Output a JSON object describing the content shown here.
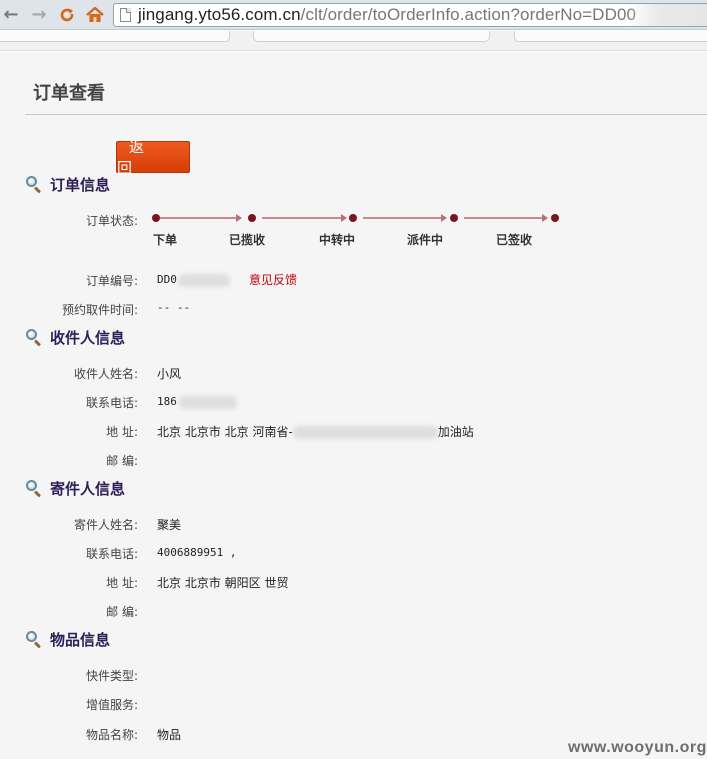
{
  "browser": {
    "url_host": "jingang.yto56.com.cn",
    "url_path": "/clt/order/toOrderInfo.action?orderNo=DD00"
  },
  "page": {
    "title": "订单查看",
    "back_label": "返 回"
  },
  "order_section": {
    "title": "订单信息",
    "status_label": "订单状态:",
    "steps": [
      "下单",
      "已揽收",
      "中转中",
      "派件中",
      "已签收"
    ],
    "order_no_label": "订单编号:",
    "order_no_prefix": "DD0",
    "feedback_link": "意见反馈",
    "pickup_time_label": "预约取件时间:",
    "pickup_time": "-- --"
  },
  "receiver_section": {
    "title": "收件人信息",
    "name_label": "收件人姓名:",
    "name": "小风",
    "phone_label": "联系电话:",
    "phone_prefix": "186",
    "address_label": "地  址:",
    "address_prefix": "北京 北京市 北京 河南省-",
    "address_suffix": "加油站",
    "zip_label": "邮  编:",
    "zip": ""
  },
  "sender_section": {
    "title": "寄件人信息",
    "name_label": "寄件人姓名:",
    "name": "聚美",
    "phone_label": "联系电话:",
    "phone": "4006889951 ,",
    "address_label": "地  址:",
    "address": "北京 北京市 朝阳区 世贸",
    "zip_label": "邮  编:",
    "zip": ""
  },
  "goods_section": {
    "title": "物品信息",
    "type_label": "快件类型:",
    "type": "",
    "service_label": "增值服务:",
    "service": "",
    "name_label": "物品名称:",
    "name": "物品"
  },
  "watermark": "www.wooyun.org",
  "colors": {
    "accent_orange": "#e04a12",
    "track_dot": "#7a1420",
    "link_red": "#c8000a",
    "section_title": "#2c1f56"
  }
}
